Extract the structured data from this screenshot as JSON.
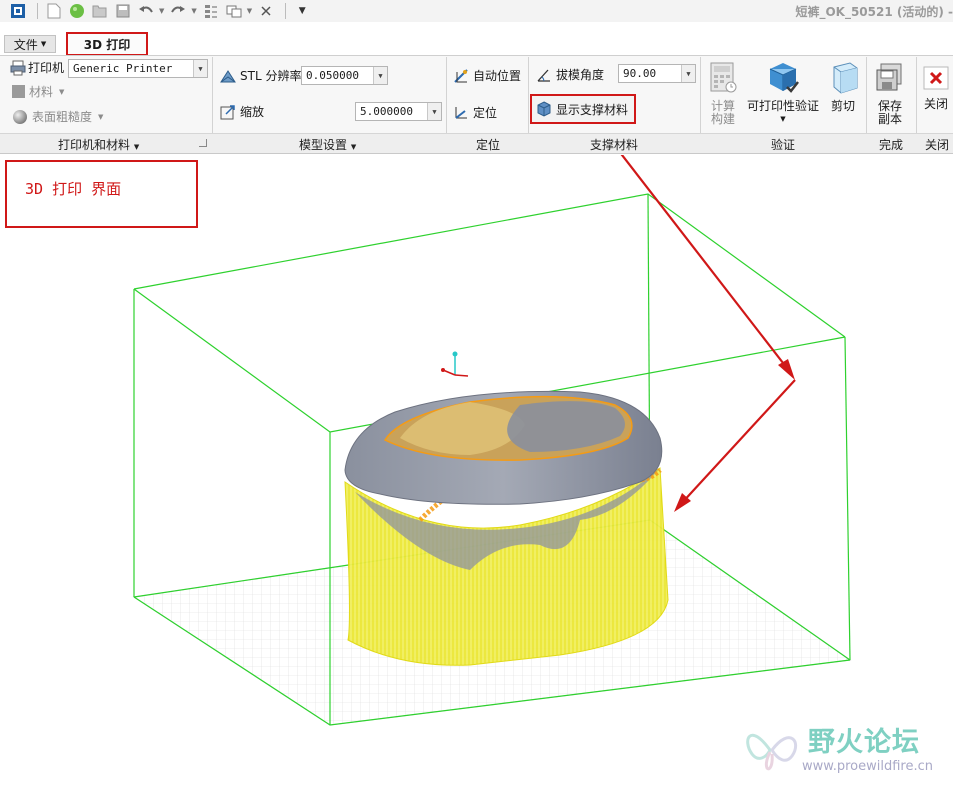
{
  "window_title": "短裤_OK_50521 (活动的) -",
  "quick_access": {
    "icons": [
      "app-icon",
      "new-icon",
      "globe-icon",
      "open-icon",
      "save-icon",
      "undo-icon",
      "redo-icon",
      "regenerate-icon",
      "windows-icon",
      "close-window-icon",
      "customize-icon"
    ]
  },
  "tabs": {
    "file": "文件",
    "print3d": "3D 打印"
  },
  "ribbon": {
    "printer_material": {
      "printer_label": "打印机",
      "printer_value": "Generic Printer",
      "material_label": "材料",
      "roughness_label": "表面粗糙度",
      "group_label": "打印机和材料"
    },
    "model_settings": {
      "stl_label": "STL 分辨率",
      "stl_value": "0.050000",
      "scale_label": "缩放",
      "scale_value": "5.000000",
      "group_label": "模型设置"
    },
    "positioning": {
      "auto_position_label": "自动位置",
      "position_label": "定位",
      "group_label": "定位"
    },
    "support": {
      "draft_angle_label": "拔模角度",
      "draft_angle_value": "90.00",
      "show_support_label": "显示支撑材料",
      "group_label": "支撑材料"
    },
    "verify": {
      "compute_build_label_1": "计算",
      "compute_build_label_2": "构建",
      "printability_label": "可打印性验证",
      "cut_label": "剪切",
      "group_label": "验证"
    },
    "finish": {
      "save_copy_label_1": "保存",
      "save_copy_label_2": "副本",
      "group_label": "完成"
    },
    "close": {
      "close_label": "关闭",
      "group_label": "关闭"
    }
  },
  "annotation": {
    "text": "3D 打印 界面"
  },
  "watermark": {
    "title": "野火论坛",
    "url": "www.proewildfire.cn"
  },
  "colors": {
    "highlight_red": "#d01818",
    "build_box_green": "#2ed12e",
    "support_yellow": "#f2f02a",
    "model_gray": "#8a8f9c",
    "model_orange": "#f59b14"
  }
}
